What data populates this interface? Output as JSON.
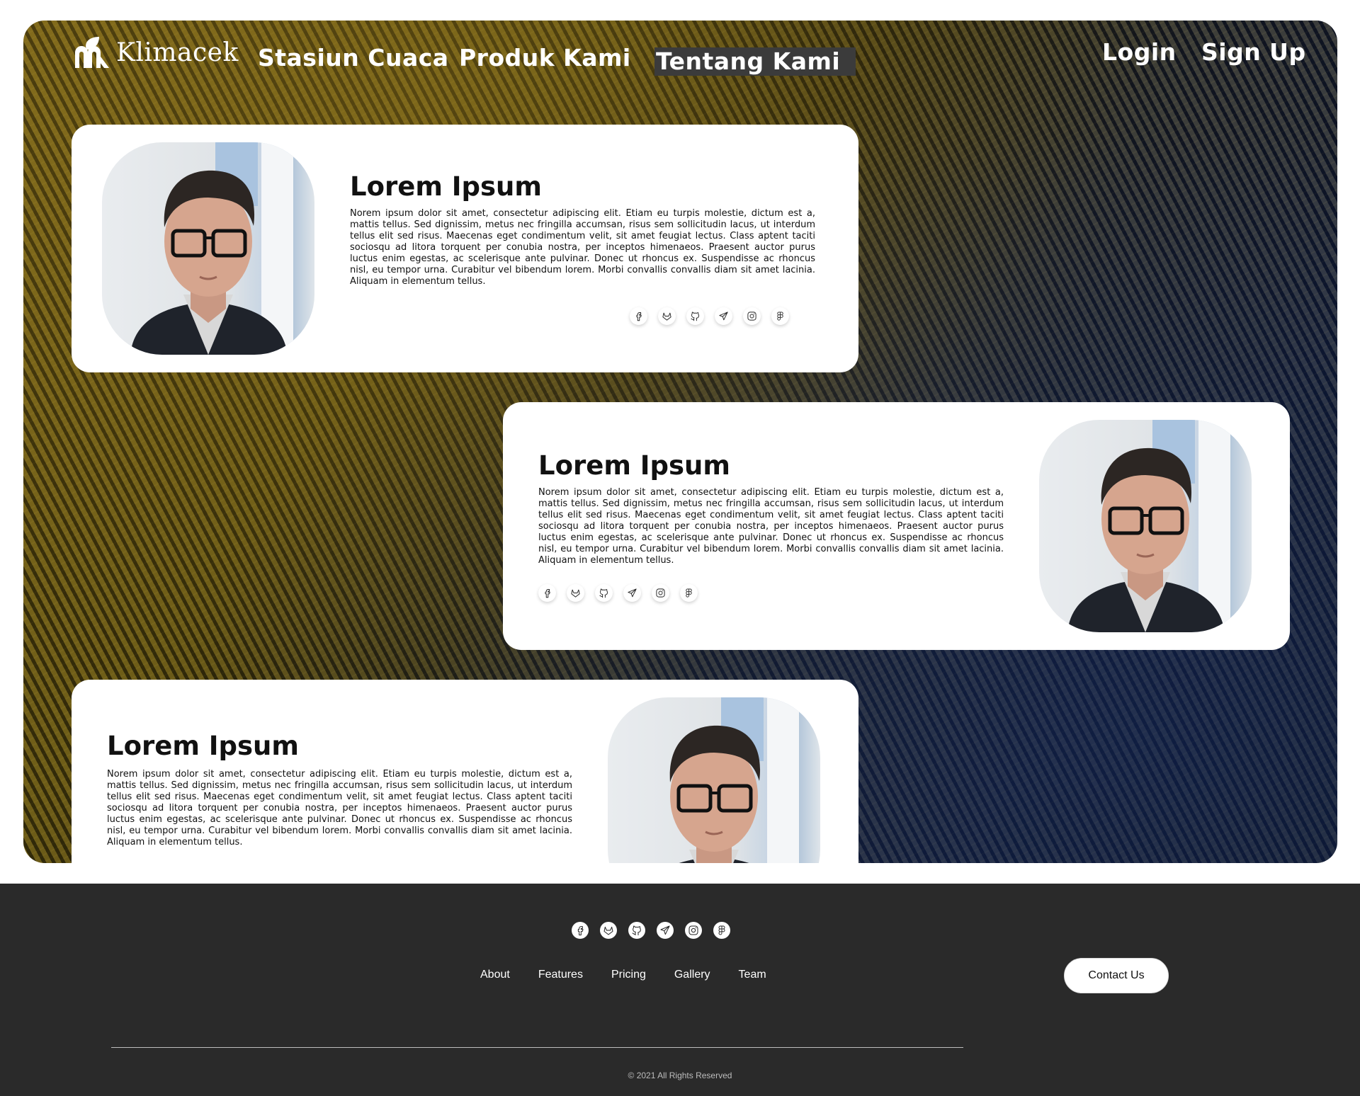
{
  "nav": {
    "brand": "Klimacek",
    "links": [
      "Stasiun Cuaca",
      "Produk Kami",
      "Tentang Kami"
    ],
    "active_link": "Tentang Kami",
    "login": "Login",
    "signup": "Sign Up"
  },
  "cards": [
    {
      "title": "Lorem Ipsum",
      "body": "Norem ipsum dolor sit amet, consectetur adipiscing elit. Etiam eu turpis molestie, dictum est a, mattis tellus. Sed dignissim, metus nec fringilla accumsan, risus sem sollicitudin lacus, ut interdum tellus elit sed risus. Maecenas eget condimentum velit, sit amet feugiat lectus. Class aptent taciti sociosqu ad litora torquent per conubia nostra, per inceptos himenaeos. Praesent auctor purus luctus enim egestas, ac scelerisque ante pulvinar. Donec ut rhoncus ex. Suspendisse ac rhoncus nisl, eu tempor urna. Curabitur vel bibendum lorem. Morbi convallis convallis diam sit amet lacinia. Aliquam in elementum tellus."
    },
    {
      "title": "Lorem Ipsum",
      "body": "Norem ipsum dolor sit amet, consectetur adipiscing elit. Etiam eu turpis molestie, dictum est a, mattis tellus. Sed dignissim, metus nec fringilla accumsan, risus sem sollicitudin lacus, ut interdum tellus elit sed risus. Maecenas eget condimentum velit, sit amet feugiat lectus. Class aptent taciti sociosqu ad litora torquent per conubia nostra, per inceptos himenaeos. Praesent auctor purus luctus enim egestas, ac scelerisque ante pulvinar. Donec ut rhoncus ex. Suspendisse ac rhoncus nisl, eu tempor urna. Curabitur vel bibendum lorem. Morbi convallis convallis diam sit amet lacinia. Aliquam in elementum tellus."
    },
    {
      "title": "Lorem Ipsum",
      "body": "Norem ipsum dolor sit amet, consectetur adipiscing elit. Etiam eu turpis molestie, dictum est a, mattis tellus. Sed dignissim, metus nec fringilla accumsan, risus sem sollicitudin lacus, ut interdum tellus elit sed risus. Maecenas eget condimentum velit, sit amet feugiat lectus. Class aptent taciti sociosqu ad litora torquent per conubia nostra, per inceptos himenaeos. Praesent auctor purus luctus enim egestas, ac scelerisque ante pulvinar. Donec ut rhoncus ex. Suspendisse ac rhoncus nisl, eu tempor urna. Curabitur vel bibendum lorem. Morbi convallis convallis diam sit amet lacinia. Aliquam in elementum tellus."
    }
  ],
  "social_icons": [
    "facebook-icon",
    "gitlab-icon",
    "github-icon",
    "telegram-icon",
    "instagram-icon",
    "figma-icon"
  ],
  "footer": {
    "links": [
      "About",
      "Features",
      "Pricing",
      "Gallery",
      "Team"
    ],
    "contact_button": "Contact Us",
    "copyright": "© 2021 All Rights Reserved"
  },
  "colors": {
    "footer_bg": "#2a2a2a",
    "card_bg": "#ffffff",
    "active_nav_bg": "#3b3b3b"
  }
}
